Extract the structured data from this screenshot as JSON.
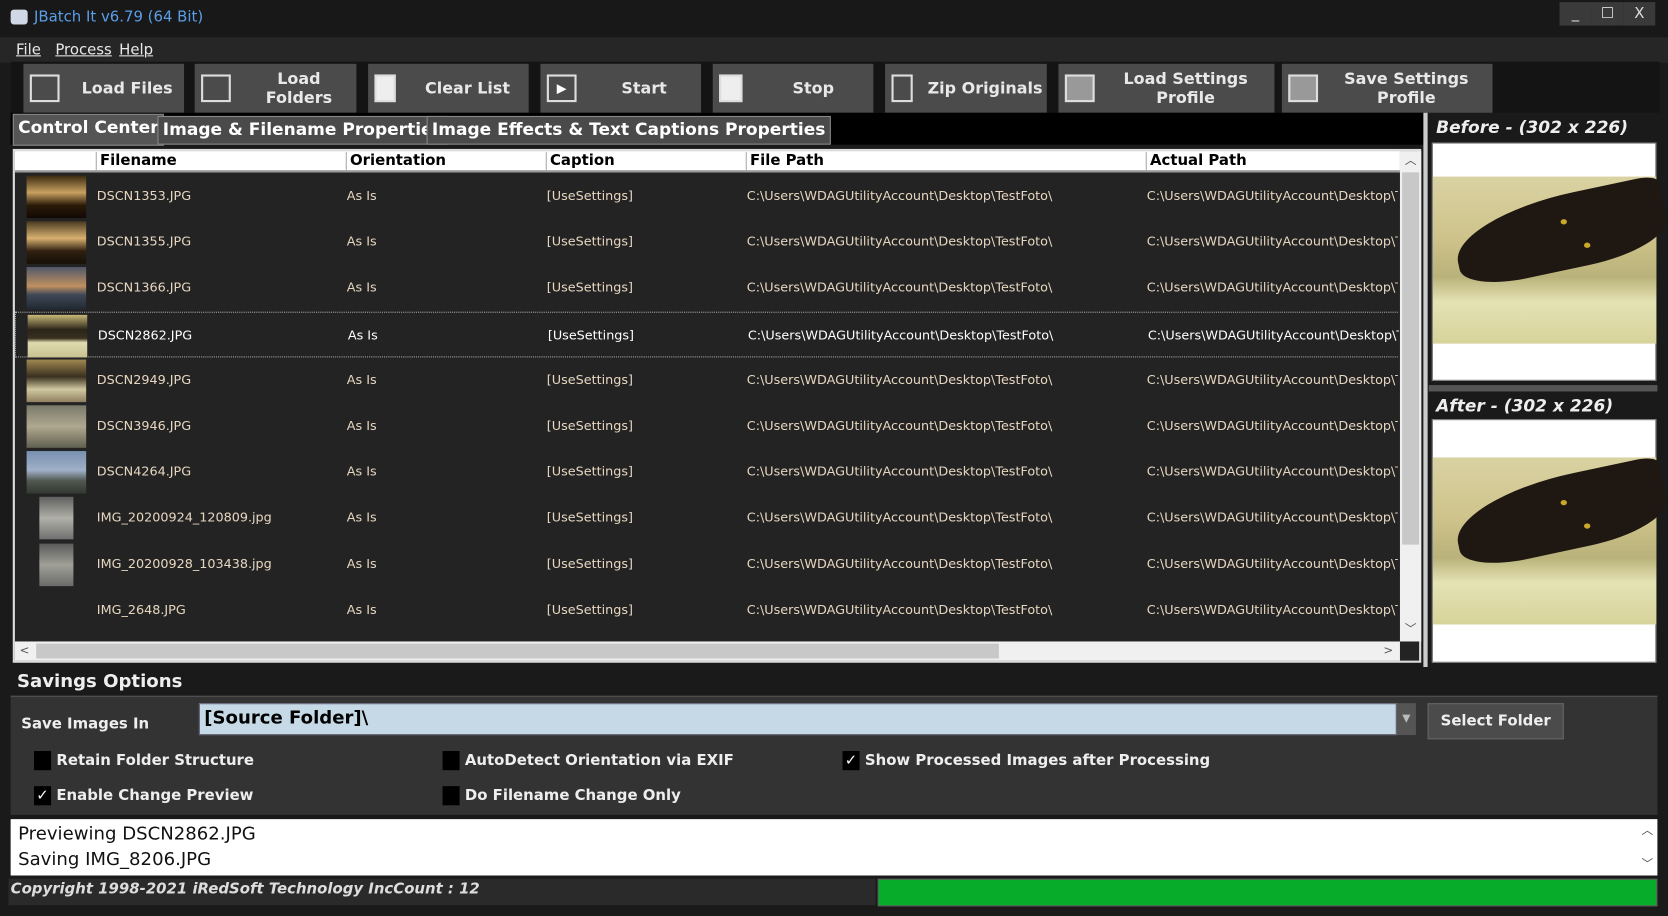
{
  "window": {
    "title": "JBatch It v6.79 (64 Bit)",
    "minimize": "_",
    "maximize": "☐",
    "close": "X"
  },
  "menu": [
    "File",
    "Process",
    "Help"
  ],
  "toolbar": {
    "load_files": "Load Files",
    "load_folders": "Load Folders",
    "clear_list": "Clear List",
    "start": "Start",
    "stop": "Stop",
    "zip_originals": "Zip Originals",
    "load_settings": "Load Settings Profile",
    "save_settings": "Save Settings Profile"
  },
  "tabs": [
    "Control Center",
    "Image & Filename Properties",
    "Image Effects & Text Captions Properties"
  ],
  "table": {
    "columns": [
      "Filename",
      "Orientation",
      "Caption",
      "File Path",
      "Actual Path"
    ],
    "rows": [
      {
        "filename": "DSCN1353.JPG",
        "orientation": "As Is",
        "caption": "[UseSettings]",
        "file_path": "C:\\Users\\WDAGUtilityAccount\\Desktop\\TestFoto\\",
        "actual_path": "C:\\Users\\WDAGUtilityAccount\\Desktop\\TestFoto\\"
      },
      {
        "filename": "DSCN1355.JPG",
        "orientation": "As Is",
        "caption": "[UseSettings]",
        "file_path": "C:\\Users\\WDAGUtilityAccount\\Desktop\\TestFoto\\",
        "actual_path": "C:\\Users\\WDAGUtilityAccount\\Desktop\\TestFoto\\"
      },
      {
        "filename": "DSCN1366.JPG",
        "orientation": "As Is",
        "caption": "[UseSettings]",
        "file_path": "C:\\Users\\WDAGUtilityAccount\\Desktop\\TestFoto\\",
        "actual_path": "C:\\Users\\WDAGUtilityAccount\\Desktop\\TestFoto\\"
      },
      {
        "filename": "DSCN2862.JPG",
        "orientation": "As Is",
        "caption": "[UseSettings]",
        "file_path": "C:\\Users\\WDAGUtilityAccount\\Desktop\\TestFoto\\",
        "actual_path": "C:\\Users\\WDAGUtilityAccount\\Desktop\\TestFoto\\",
        "selected": true
      },
      {
        "filename": "DSCN2949.JPG",
        "orientation": "As Is",
        "caption": "[UseSettings]",
        "file_path": "C:\\Users\\WDAGUtilityAccount\\Desktop\\TestFoto\\",
        "actual_path": "C:\\Users\\WDAGUtilityAccount\\Desktop\\TestFoto\\"
      },
      {
        "filename": "DSCN3946.JPG",
        "orientation": "As Is",
        "caption": "[UseSettings]",
        "file_path": "C:\\Users\\WDAGUtilityAccount\\Desktop\\TestFoto\\",
        "actual_path": "C:\\Users\\WDAGUtilityAccount\\Desktop\\TestFoto\\"
      },
      {
        "filename": "DSCN4264.JPG",
        "orientation": "As Is",
        "caption": "[UseSettings]",
        "file_path": "C:\\Users\\WDAGUtilityAccount\\Desktop\\TestFoto\\",
        "actual_path": "C:\\Users\\WDAGUtilityAccount\\Desktop\\TestFoto\\"
      },
      {
        "filename": "IMG_20200924_120809.jpg",
        "orientation": "As Is",
        "caption": "[UseSettings]",
        "file_path": "C:\\Users\\WDAGUtilityAccount\\Desktop\\TestFoto\\",
        "actual_path": "C:\\Users\\WDAGUtilityAccount\\Desktop\\TestFoto\\"
      },
      {
        "filename": "IMG_20200928_103438.jpg",
        "orientation": "As Is",
        "caption": "[UseSettings]",
        "file_path": "C:\\Users\\WDAGUtilityAccount\\Desktop\\TestFoto\\",
        "actual_path": "C:\\Users\\WDAGUtilityAccount\\Desktop\\TestFoto\\"
      },
      {
        "filename": "IMG_2648.JPG",
        "orientation": "As Is",
        "caption": "[UseSettings]",
        "file_path": "C:\\Users\\WDAGUtilityAccount\\Desktop\\TestFoto\\",
        "actual_path": "C:\\Users\\WDAGUtilityAccount\\Desktop\\TestFoto\\"
      }
    ]
  },
  "preview": {
    "before_label": "Before - (302 x 226)",
    "after_label": "After - (302 x 226)"
  },
  "savings": {
    "title": "Savings Options",
    "save_in_label": "Save Images In",
    "save_in_value": "[Source Folder]\\",
    "select_folder": "Select Folder",
    "options": [
      {
        "label": "Retain Folder Structure",
        "checked": false
      },
      {
        "label": "AutoDetect Orientation via EXIF",
        "checked": false
      },
      {
        "label": "Show Processed Images after Processing",
        "checked": true
      },
      {
        "label": "Enable Change Preview",
        "checked": true
      },
      {
        "label": "Do Filename Change Only",
        "checked": false
      }
    ]
  },
  "log": [
    "Previewing DSCN2862.JPG",
    "Saving IMG_8206.JPG"
  ],
  "status": {
    "text": "Copyright 1998-2021 iRedSoft Technology IncCount : 12",
    "progress_percent": 100,
    "progress_color": "#06ac2a"
  }
}
